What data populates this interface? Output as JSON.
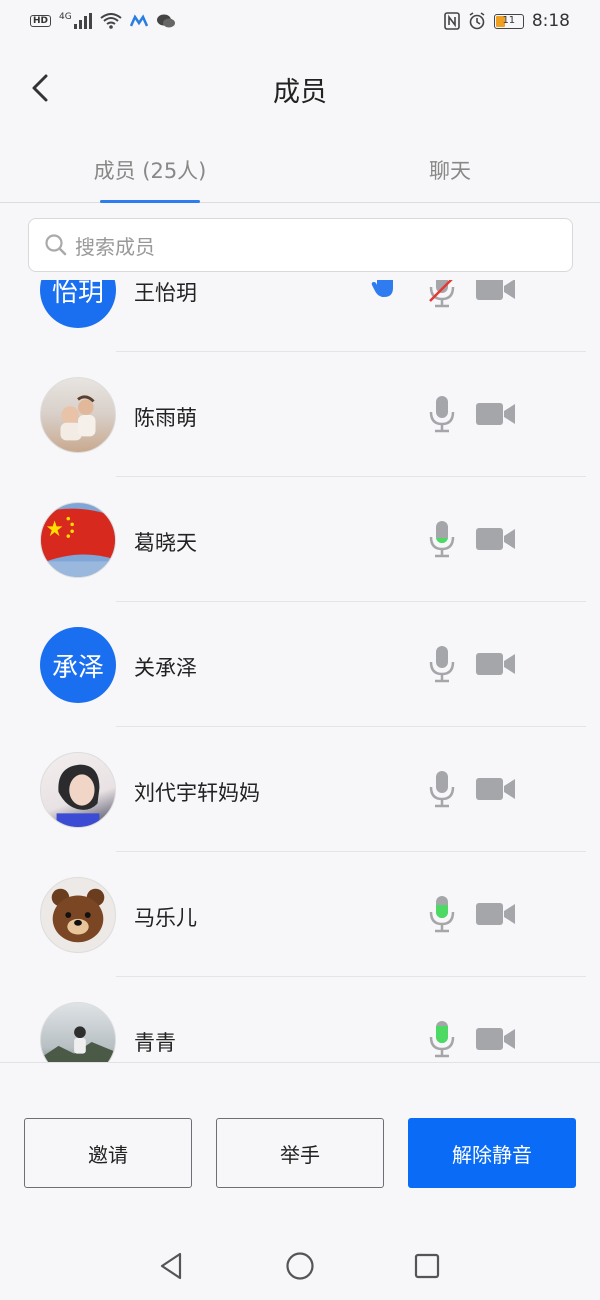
{
  "status_bar": {
    "hd": "HD",
    "network": "4G",
    "time": "8:18",
    "battery": "11",
    "battery_color": "#f0a020"
  },
  "header": {
    "title": "成员",
    "back_icon": "chevron-left-icon"
  },
  "tabs": [
    {
      "label": "成员 (25人)",
      "active": true
    },
    {
      "label": "聊天",
      "active": false
    }
  ],
  "search": {
    "placeholder": "搜索成员",
    "icon": "search-icon"
  },
  "members": [
    {
      "name": "王怡玥",
      "avatar_text": "怡玥",
      "avatar_type": "text",
      "hand_raised": true,
      "mic": "muted",
      "cam": "off"
    },
    {
      "name": "陈雨萌",
      "avatar_type": "photo",
      "avatar_desc": "baby-photo",
      "mic": "off",
      "cam": "off"
    },
    {
      "name": "葛晓天",
      "avatar_type": "photo",
      "avatar_desc": "flag-photo",
      "mic": "active-low",
      "cam": "off"
    },
    {
      "name": "关承泽",
      "avatar_text": "承泽",
      "avatar_type": "text",
      "mic": "off",
      "cam": "off"
    },
    {
      "name": "刘代宇轩妈妈",
      "avatar_type": "photo",
      "avatar_desc": "portrait-photo",
      "mic": "off",
      "cam": "off"
    },
    {
      "name": "马乐儿",
      "avatar_type": "photo",
      "avatar_desc": "bear-photo",
      "mic": "active-mid",
      "cam": "off"
    },
    {
      "name": "青青",
      "avatar_type": "photo",
      "avatar_desc": "landscape-photo",
      "mic": "active-high",
      "cam": "off"
    }
  ],
  "footer": {
    "invite_label": "邀请",
    "raise_hand_label": "举手",
    "unmute_label": "解除静音"
  },
  "colors": {
    "accent": "#0a6cf6",
    "avatar_blue": "#1a6ff0",
    "mic_active": "#4cd964",
    "muted_red": "#e53935"
  }
}
